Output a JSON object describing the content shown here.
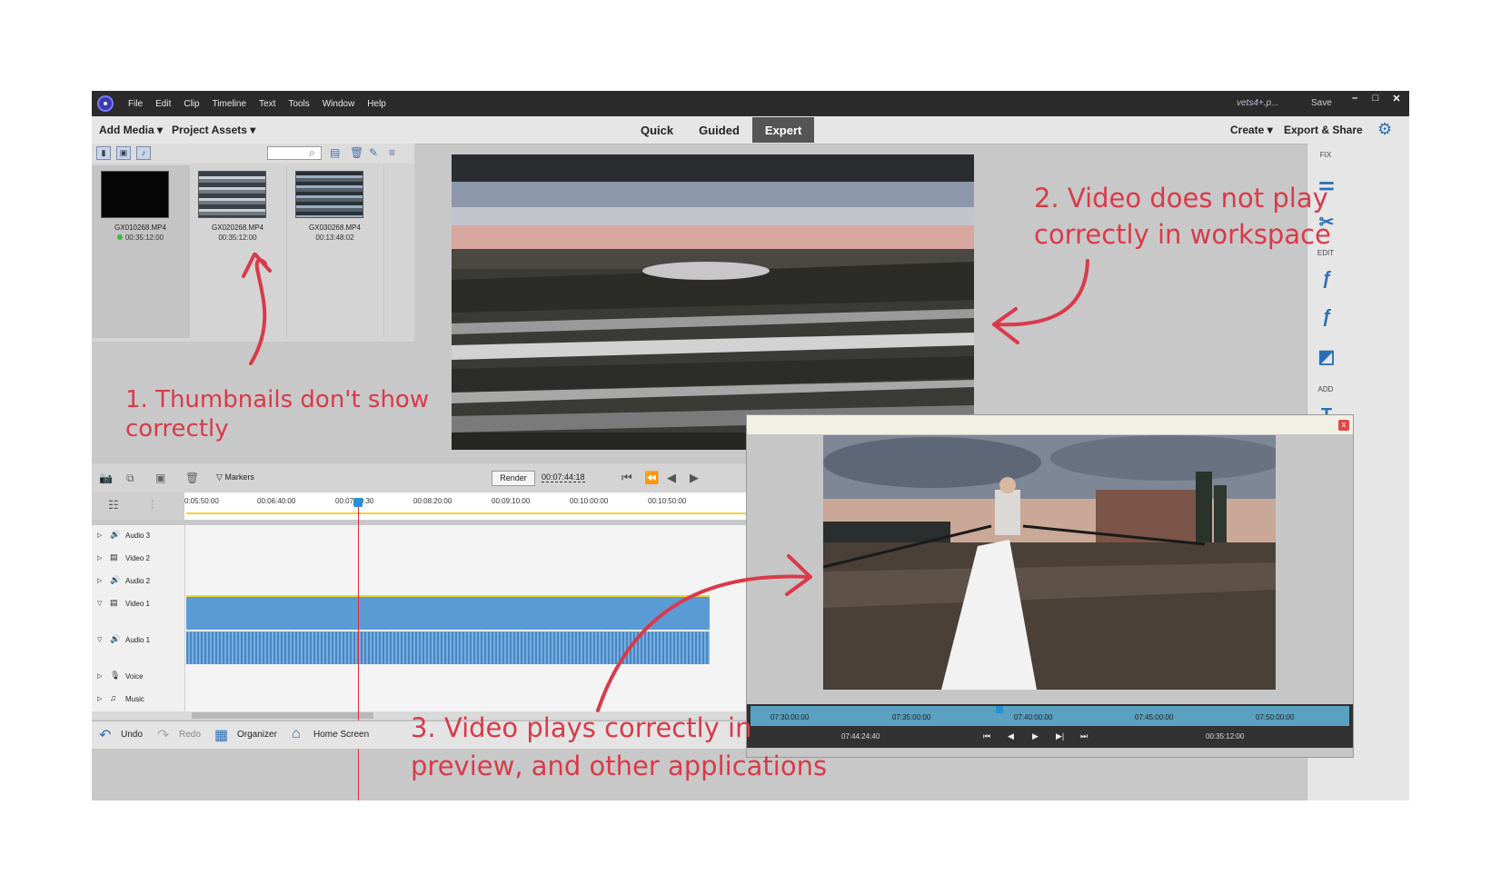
{
  "app": {
    "menu": [
      "File",
      "Edit",
      "Clip",
      "Timeline",
      "Text",
      "Tools",
      "Window",
      "Help"
    ],
    "doc_title": "vets4+.p...",
    "save": "Save"
  },
  "topbar": {
    "add_media": "Add Media",
    "project_assets": "Project Assets",
    "tabs": [
      "Quick",
      "Guided",
      "Expert"
    ],
    "active_tab": "Expert",
    "create": "Create",
    "export_share": "Export & Share"
  },
  "assets": [
    {
      "name": "GX010268.MP4",
      "duration": "00:35:12:00"
    },
    {
      "name": "GX020268.MP4",
      "duration": "00:35:12:00"
    },
    {
      "name": "GX030268.MP4",
      "duration": "00:13:48:02"
    }
  ],
  "timeline": {
    "markers": "Markers",
    "render": "Render",
    "timecode": "00:07:44:18",
    "ruler": [
      "0:05:50:00",
      "00:06:40:00",
      "00:07:30:30",
      "00:08:20:00",
      "00:09:10:00",
      "00:10:00:00",
      "00:10:50:00"
    ],
    "tracks": [
      "Audio 3",
      "Video 2",
      "Audio 2",
      "Video 1",
      "Audio 1",
      "Voice",
      "Music"
    ]
  },
  "bottombar": {
    "undo": "Undo",
    "redo": "Redo",
    "organizer": "Organizer",
    "home": "Home Screen"
  },
  "rightpanel": {
    "fix": "FIX",
    "edit": "EDIT",
    "add": "ADD"
  },
  "preview": {
    "close": "x",
    "ruler": [
      "07:30:00:00",
      "07:35:00:00",
      "07:40:00:00",
      "07:45:00:00",
      "07:50:00:00"
    ],
    "current": "07:44:24:40",
    "duration": "00:35:12:00"
  },
  "annotations": {
    "a1_line1": "1. Thumbnails don't show",
    "a1_line2": "correctly",
    "a2_line1": "2. Video does not play",
    "a2_line2": "correctly in workspace",
    "a3_line1": "3. Video plays correctly in",
    "a3_line2": "preview, and other applications"
  },
  "colors": {
    "annotation": "#d93a4a",
    "accent": "#2a6fb5",
    "clip": "#5b9bd5"
  }
}
